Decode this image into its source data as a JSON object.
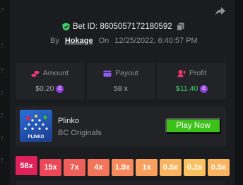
{
  "left_edge_labels": [
    "7:",
    "7.",
    "7:",
    "7.",
    "7.",
    "7.",
    "7."
  ],
  "bet_id_label": "Bet ID: 8605057172180592",
  "by_label": "By",
  "username": "Hokage",
  "on_label": "On",
  "datetime": "12/25/2022, 6:40:57 PM",
  "stats": [
    {
      "label": "Amount",
      "value": "$0.20",
      "icon": "coins-icon",
      "color": "#e9386b"
    },
    {
      "label": "Payout",
      "value": "58 x",
      "icon": "wallet-icon",
      "color": "#8f5bf0"
    },
    {
      "label": "Profit",
      "value": "$11.40",
      "icon": "profit-icon",
      "color": "#e9386b"
    }
  ],
  "game": {
    "thumb_label": "PLINKO",
    "name": "Plinko",
    "provider": "BC Originals",
    "play_label": "Play Now"
  },
  "multipliers": [
    {
      "label": "58x",
      "color": "#e0225a",
      "hit": true
    },
    {
      "label": "15x",
      "color": "#ec4757",
      "hit": false
    },
    {
      "label": "7x",
      "color": "#f0605a",
      "hit": false
    },
    {
      "label": "4x",
      "color": "#f4755a",
      "hit": false
    },
    {
      "label": "1.9x",
      "color": "#f78a5c",
      "hit": false
    },
    {
      "label": "1x",
      "color": "#f9a05e",
      "hit": false
    },
    {
      "label": "0.5x",
      "color": "#fab35f",
      "hit": false
    },
    {
      "label": "0.2x",
      "color": "#fbc160",
      "hit": false
    },
    {
      "label": "0.5x",
      "color": "#fab35f",
      "hit": false
    }
  ]
}
